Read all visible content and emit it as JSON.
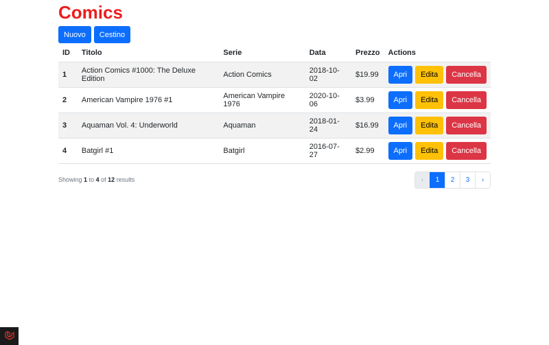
{
  "page": {
    "title": "Comics"
  },
  "toolbar": {
    "new_label": "Nuovo",
    "trash_label": "Cestino"
  },
  "table": {
    "headers": {
      "id": "ID",
      "title": "Titolo",
      "series": "Serie",
      "date": "Data",
      "price": "Prezzo",
      "actions": "Actions"
    },
    "rows": [
      {
        "id": "1",
        "title": "Action Comics #1000: The Deluxe Edition",
        "series": "Action Comics",
        "date": "2018-10-02",
        "price": "$19.99"
      },
      {
        "id": "2",
        "title": "American Vampire 1976 #1",
        "series": "American Vampire 1976",
        "date": "2020-10-06",
        "price": "$3.99"
      },
      {
        "id": "3",
        "title": "Aquaman Vol. 4: Underworld",
        "series": "Aquaman",
        "date": "2018-01-24",
        "price": "$16.99"
      },
      {
        "id": "4",
        "title": "Batgirl #1",
        "series": "Batgirl",
        "date": "2016-07-27",
        "price": "$2.99"
      }
    ],
    "row_actions": {
      "open": "Apri",
      "edit": "Edita",
      "delete": "Cancella"
    }
  },
  "footer": {
    "showing_prefix": "Showing",
    "from": "1",
    "to_word": "to",
    "to": "4",
    "of_word": "of",
    "total": "12",
    "results_word": "results"
  },
  "pagination": {
    "prev": "‹",
    "pages": [
      "1",
      "2",
      "3"
    ],
    "next": "›",
    "active": "1"
  },
  "colors": {
    "title": "#ec1d1d",
    "primary": "#0d6efd",
    "warning": "#ffc107",
    "danger": "#dc3545"
  },
  "icons": {
    "debug_logo": "laravel-logo-icon"
  }
}
